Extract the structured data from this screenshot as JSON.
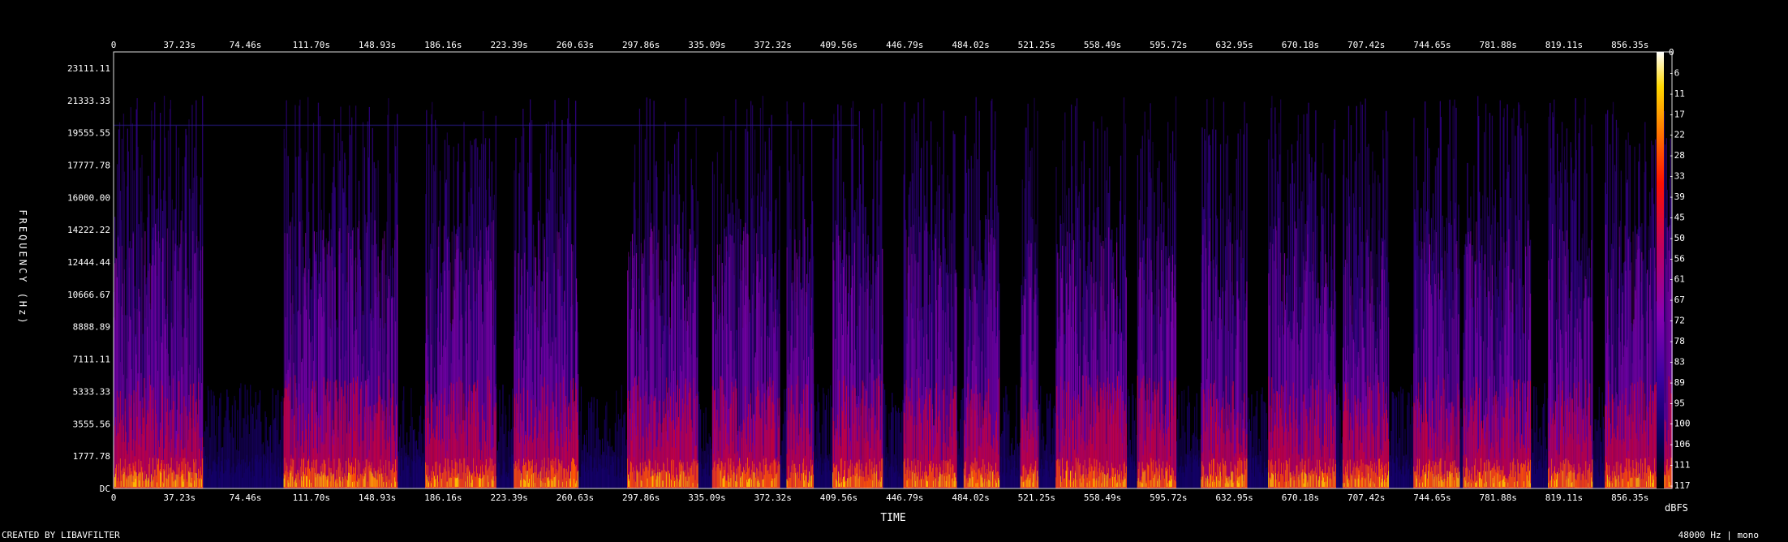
{
  "chart_data": {
    "type": "heatmap",
    "title": "",
    "xlabel": "TIME",
    "ylabel": "FREQUENCY (Hz)",
    "x_ticks": [
      "0",
      "37.23s",
      "74.46s",
      "111.70s",
      "148.93s",
      "186.16s",
      "223.39s",
      "260.63s",
      "297.86s",
      "335.09s",
      "372.32s",
      "409.56s",
      "446.79s",
      "484.02s",
      "521.25s",
      "558.49s",
      "595.72s",
      "632.95s",
      "670.18s",
      "707.42s",
      "744.65s",
      "781.88s",
      "819.11s",
      "856.35s"
    ],
    "y_ticks": [
      "DC",
      "1777.78",
      "3555.56",
      "5333.33",
      "7111.11",
      "8888.89",
      "10666.67",
      "12444.44",
      "14222.22",
      "16000.00",
      "17777.78",
      "19555.55",
      "21333.33",
      "23111.11"
    ],
    "colorbar_label": "dBFS",
    "colorbar_ticks": [
      "0",
      "-6",
      "-11",
      "-17",
      "-22",
      "-28",
      "-33",
      "-39",
      "-45",
      "-50",
      "-56",
      "-61",
      "-67",
      "-72",
      "-78",
      "-83",
      "-89",
      "-95",
      "-100",
      "-106",
      "-111",
      "-117"
    ],
    "xlim": [
      0,
      880
    ],
    "ylim": [
      0,
      24000
    ],
    "zlim": [
      -120,
      0
    ],
    "colormap": [
      "#000000",
      "#0a0060",
      "#3a00a0",
      "#8a00b0",
      "#c00060",
      "#ff1000",
      "#ff7a00",
      "#ffd800",
      "#ffffff"
    ],
    "active_segments_s": [
      [
        0,
        50
      ],
      [
        96,
        160
      ],
      [
        176,
        216
      ],
      [
        226,
        262
      ],
      [
        290,
        330
      ],
      [
        338,
        376
      ],
      [
        380,
        395
      ],
      [
        406,
        434
      ],
      [
        446,
        476
      ],
      [
        480,
        500
      ],
      [
        512,
        522
      ],
      [
        532,
        572
      ],
      [
        578,
        600
      ],
      [
        614,
        640
      ],
      [
        652,
        690
      ],
      [
        694,
        720
      ],
      [
        734,
        760
      ],
      [
        762,
        800
      ],
      [
        810,
        835
      ],
      [
        842,
        880
      ]
    ],
    "quiet_segments_s": [
      [
        50,
        96
      ],
      [
        160,
        176
      ],
      [
        216,
        226
      ],
      [
        262,
        290
      ],
      [
        330,
        338
      ],
      [
        376,
        380
      ],
      [
        395,
        406
      ],
      [
        434,
        446
      ],
      [
        476,
        480
      ],
      [
        500,
        512
      ],
      [
        522,
        532
      ],
      [
        572,
        578
      ],
      [
        600,
        614
      ],
      [
        640,
        652
      ],
      [
        690,
        694
      ],
      [
        720,
        734
      ],
      [
        760,
        762
      ],
      [
        800,
        810
      ],
      [
        835,
        842
      ]
    ]
  },
  "footer": {
    "created_by": "CREATED BY LIBAVFILTER",
    "format": "48000 Hz | mono"
  }
}
